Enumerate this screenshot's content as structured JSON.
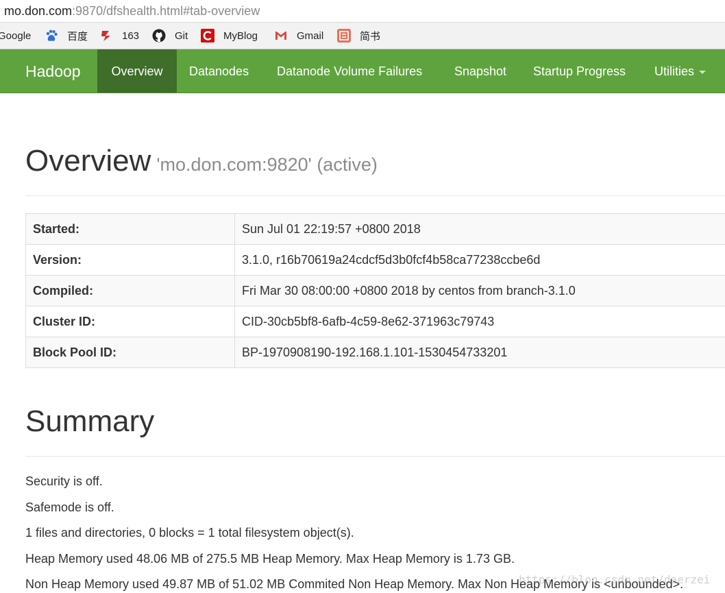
{
  "browser": {
    "url_host": "mo.don.com",
    "url_rest": ":9870/dfshealth.html#tab-overview",
    "bookmarks": [
      {
        "label": "Google",
        "icon": "google-icon"
      },
      {
        "label": "百度",
        "icon": "baidu-paw-icon",
        "color": "#2f6fd6"
      },
      {
        "label": "163",
        "icon": "netease-icon",
        "color": "#d22b2b"
      },
      {
        "label": "Git",
        "icon": "github-icon",
        "color": "#222222"
      },
      {
        "label": "MyBlog",
        "icon": "csdn-icon",
        "color": "#d40d0d"
      },
      {
        "label": "Gmail",
        "icon": "gmail-icon",
        "color": "#d84b3e"
      },
      {
        "label": "简书",
        "icon": "jianshu-icon",
        "color": "#ea6f5a"
      }
    ]
  },
  "navbar": {
    "brand": "Hadoop",
    "color": "#5fa33e",
    "active_color": "#3e6e2a",
    "items": [
      {
        "label": "Overview",
        "active": true
      },
      {
        "label": "Datanodes"
      },
      {
        "label": "Datanode Volume Failures"
      },
      {
        "label": "Snapshot"
      },
      {
        "label": "Startup Progress"
      },
      {
        "label": "Utilities",
        "dropdown": true
      }
    ]
  },
  "overview": {
    "title": "Overview",
    "subtitle": "'mo.don.com:9820' (active)",
    "rows": [
      {
        "key": "Started:",
        "value": "Sun Jul 01 22:19:57 +0800 2018"
      },
      {
        "key": "Version:",
        "value": "3.1.0, r16b70619a24cdcf5d3b0fcf4b58ca77238ccbe6d"
      },
      {
        "key": "Compiled:",
        "value": "Fri Mar 30 08:00:00 +0800 2018 by centos from branch-3.1.0"
      },
      {
        "key": "Cluster ID:",
        "value": "CID-30cb5bf8-6afb-4c59-8e62-371963c79743"
      },
      {
        "key": "Block Pool ID:",
        "value": "BP-1970908190-192.168.1.101-1530454733201"
      }
    ]
  },
  "summary": {
    "title": "Summary",
    "lines": [
      "Security is off.",
      "Safemode is off.",
      "1 files and directories, 0 blocks = 1 total filesystem object(s).",
      "Heap Memory used 48.06 MB of 275.5 MB Heap Memory. Max Heap Memory is 1.73 GB.",
      "Non Heap Memory used 49.87 MB of 51.02 MB Commited Non Heap Memory. Max Non Heap Memory is <unbounded>."
    ]
  },
  "watermark": "https://blog.csdn.net/daerzei"
}
